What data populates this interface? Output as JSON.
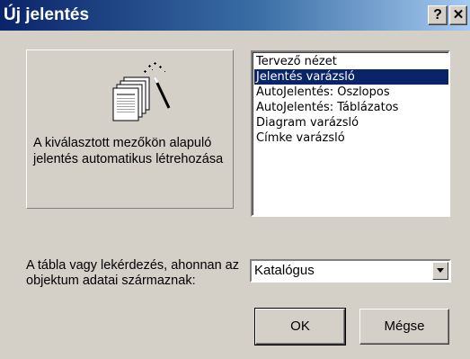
{
  "window": {
    "title": "Új jelentés",
    "help_button": "?",
    "close_button": "✕"
  },
  "preview": {
    "icon": "report-wizard-icon",
    "description": "A kiválasztott mezőkön alapuló jelentés automatikus létrehozása"
  },
  "report_types": [
    {
      "label": "Tervező nézet",
      "selected": false
    },
    {
      "label": "Jelentés varázsló",
      "selected": true
    },
    {
      "label": "AutoJelentés: Oszlopos",
      "selected": false
    },
    {
      "label": "AutoJelentés: Táblázatos",
      "selected": false
    },
    {
      "label": "Diagram varázsló",
      "selected": false
    },
    {
      "label": "Címke varázsló",
      "selected": false
    }
  ],
  "source": {
    "label": "A tábla vagy lekérdezés, ahonnan az objektum adatai származnak:",
    "value": "Katalógus"
  },
  "buttons": {
    "ok": "OK",
    "cancel": "Mégse"
  },
  "colors": {
    "titlebar_start": "#0a246a",
    "titlebar_end": "#a6caf0",
    "selection": "#0a246a",
    "face": "#d4d0c8"
  }
}
